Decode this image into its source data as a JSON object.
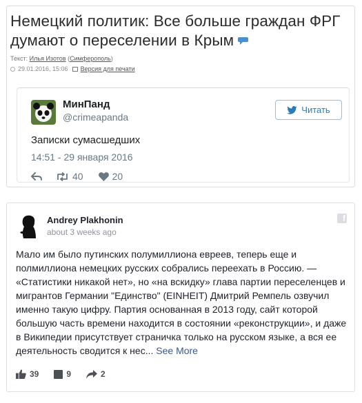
{
  "article": {
    "headline": "Немецкий политик: Все больше граждан ФРГ думают о переселении в Крым",
    "author_prefix": "Текст: ",
    "author_name": "Илья Изотов",
    "author_city": "Симферополь",
    "date": "29.01.2016, 15:06",
    "print_label": "Версия для печати"
  },
  "tweet": {
    "author_name": "МинПанд",
    "handle": "@crimeapanda",
    "follow_label": "Читать",
    "text": "Записки сумасшедших",
    "timestamp": "14:51 - 29 января 2016",
    "retweets": "40",
    "likes": "20",
    "accent_color": "#2b7bb9"
  },
  "fb_comment": {
    "author_name": "Andrey Plakhonin",
    "time": "about 3 weeks ago",
    "text": "Мало им было путинских полумиллиона евреев, теперь еще и полмиллиона немецких русских собрались переехать в Россию. — «Статистики никакой нет», но «на вскидку» глава партии переселенцев и мигрантов Германии \"Единство\" (EINHEIT) Дмитрий Ремпель озвучил именно такую цифру. Партия основанная в 2013 году, сайт которой большую часть времени находится в состоянии «реконструкции», и даже в Википедии присутствует страничка только на русском языке, а вся ее деятельность сводится к нес...",
    "see_more": "See More",
    "likes": "39",
    "comments": "9",
    "shares": "2",
    "link_color": "#365899"
  }
}
